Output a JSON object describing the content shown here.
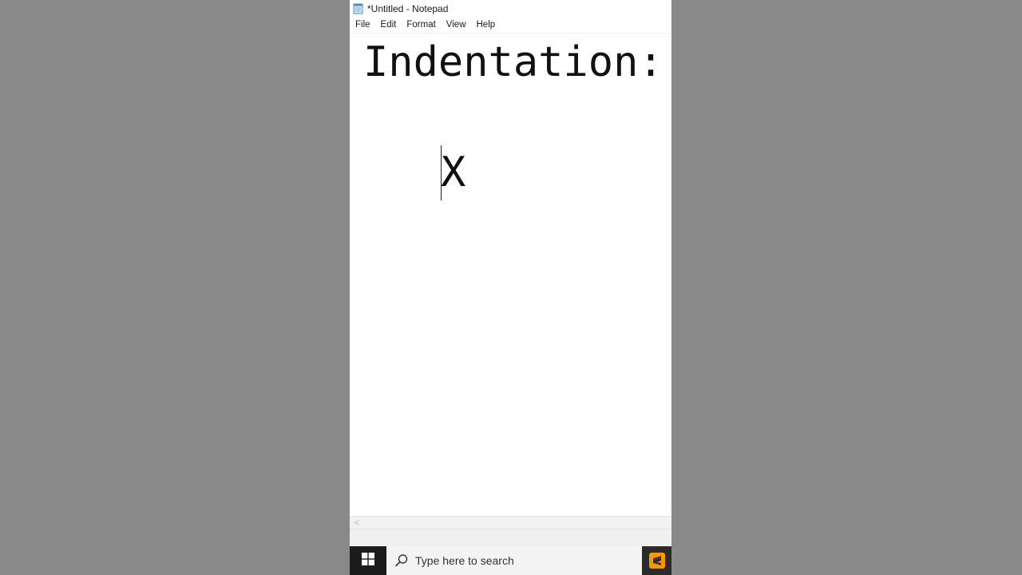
{
  "window": {
    "title": "*Untitled - Notepad",
    "app_icon": "notepad-icon"
  },
  "menu": {
    "items": [
      "File",
      "Edit",
      "Format",
      "View",
      "Help"
    ]
  },
  "editor": {
    "line1": "Indentation:",
    "line2": "X"
  },
  "scrollbar": {
    "left_arrow": "<"
  },
  "taskbar": {
    "start_icon": "windows-logo-icon",
    "search_placeholder": "Type here to search",
    "search_icon": "search-icon",
    "pinned_app_icon": "sublime-text-icon"
  },
  "colors": {
    "desktop_background": "#898989",
    "taskbar_background": "#1c1c1c",
    "sublime_accent": "#ff9800"
  }
}
